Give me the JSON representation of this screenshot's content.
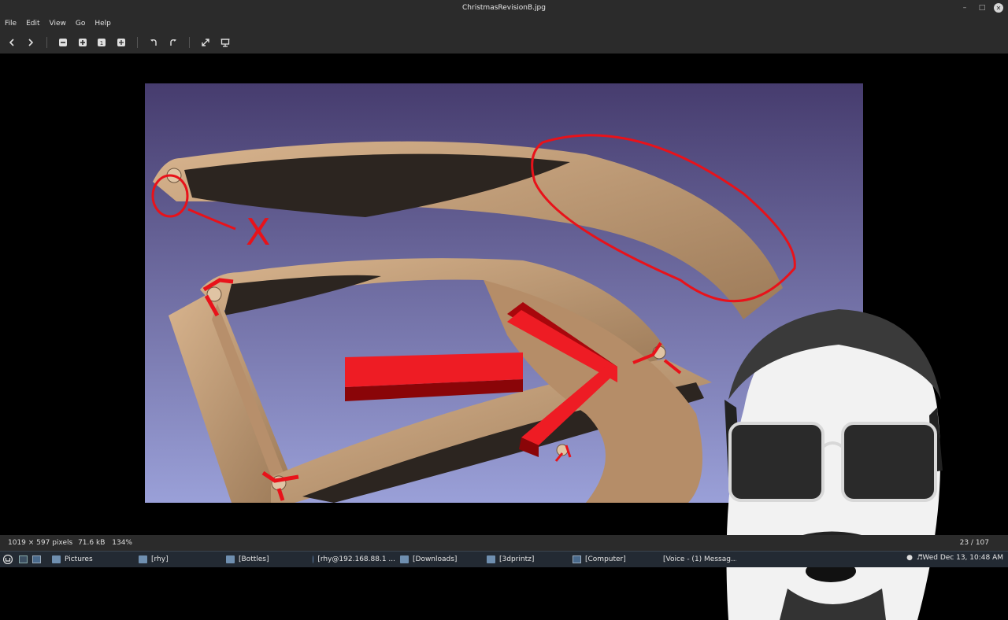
{
  "window": {
    "title": "ChristmasRevisionB.jpg"
  },
  "menu": {
    "items": [
      "File",
      "Edit",
      "View",
      "Go",
      "Help"
    ]
  },
  "toolbar": {
    "buttons": [
      "back-icon",
      "forward-icon",
      "zoom-out-icon",
      "zoom-in-icon",
      "zoom-1-icon",
      "zoom-fit-icon",
      "rotate-left-icon",
      "rotate-right-icon",
      "fullscreen-icon",
      "slideshow-icon"
    ],
    "zoom_one_label": "1"
  },
  "image": {
    "annotation_x": "X",
    "colors": {
      "background_top": "#463c6e",
      "background_bottom": "#9aa0d8",
      "part": "#c8a27e",
      "annotation": "#e8121a"
    }
  },
  "status": {
    "dimensions": "1019 × 597 pixels",
    "size": "71.6 kB",
    "zoom": "134%",
    "position": "23 / 107"
  },
  "taskbar": {
    "items": [
      {
        "label": "Pictures",
        "icon": "folder-icon"
      },
      {
        "label": "[rhy]",
        "icon": "folder-icon"
      },
      {
        "label": "[Bottles]",
        "icon": "folder-icon"
      },
      {
        "label": "[rhy@192.168.88.1 ...",
        "icon": "globe-icon"
      },
      {
        "label": "[Downloads]",
        "icon": "folder-icon"
      },
      {
        "label": "[3dprintz]",
        "icon": "folder-icon"
      },
      {
        "label": "[Computer]",
        "icon": "computer-icon"
      },
      {
        "label": "[Voice - (1) Messag...",
        "icon": "voice-icon"
      }
    ],
    "clock": "Wed Dec 13, 10:48 AM"
  }
}
